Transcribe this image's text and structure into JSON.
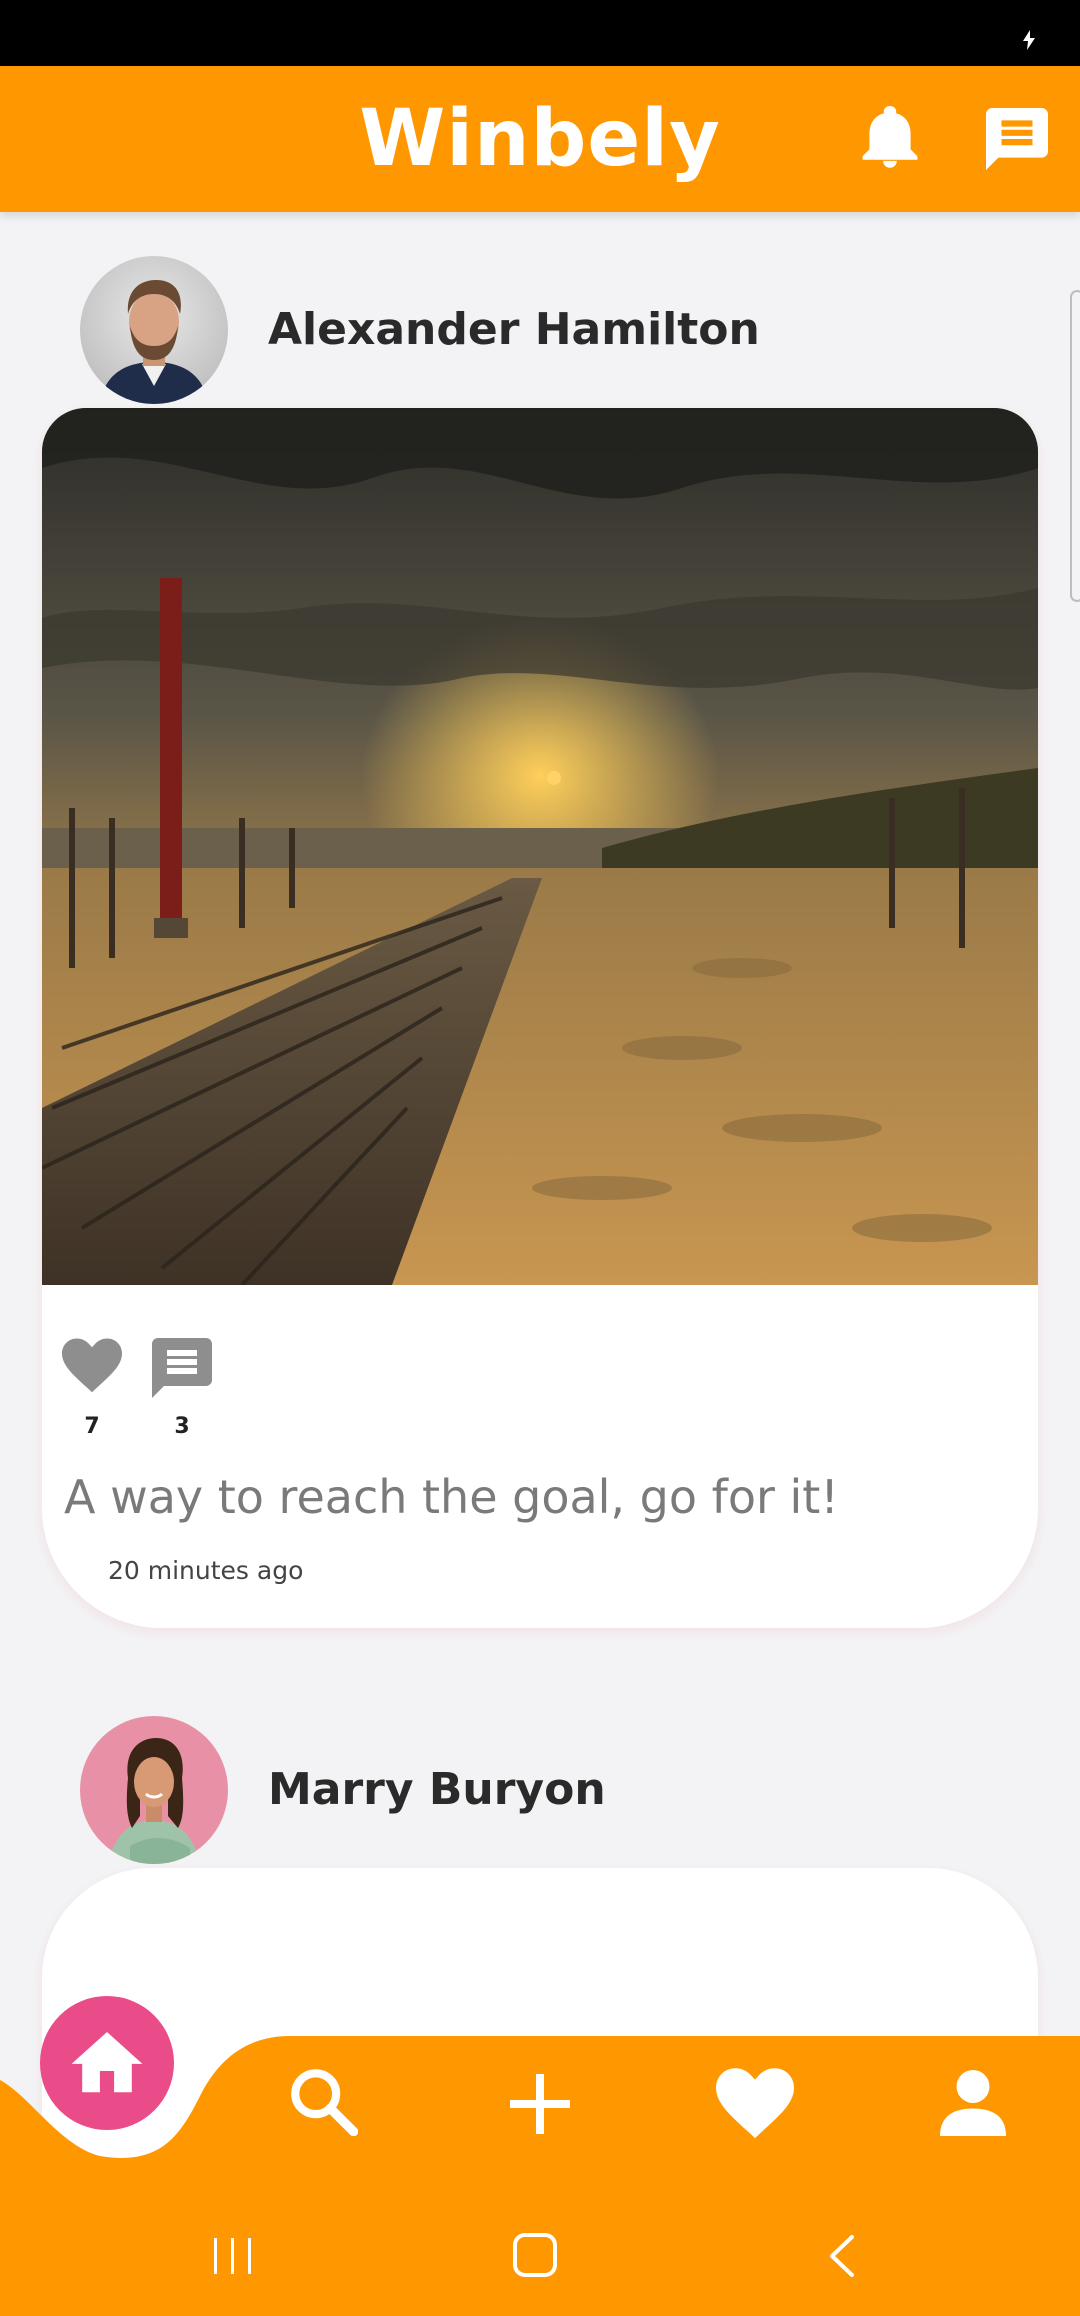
{
  "app": {
    "title": "Winbely"
  },
  "colors": {
    "primary": "#ff9800",
    "fab": "#ea4c89",
    "icon_gray": "#8e8e8e",
    "background": "#f3f3f5"
  },
  "header": {
    "bell_icon": "bell-icon",
    "chat_icon": "chat-icon"
  },
  "posts": [
    {
      "author": "Alexander Hamilton",
      "image_desc": "beach-boardwalk-sunset",
      "likes": "7",
      "comments": "3",
      "caption": "A way to reach the goal, go for it!",
      "time": "20 minutes ago"
    },
    {
      "author": "Marry Buryon"
    }
  ],
  "bottom_nav": {
    "items": [
      "home-icon",
      "search-icon",
      "add-icon",
      "heart-icon",
      "profile-icon"
    ]
  },
  "system_nav": [
    "recents-button",
    "home-button",
    "back-button"
  ]
}
